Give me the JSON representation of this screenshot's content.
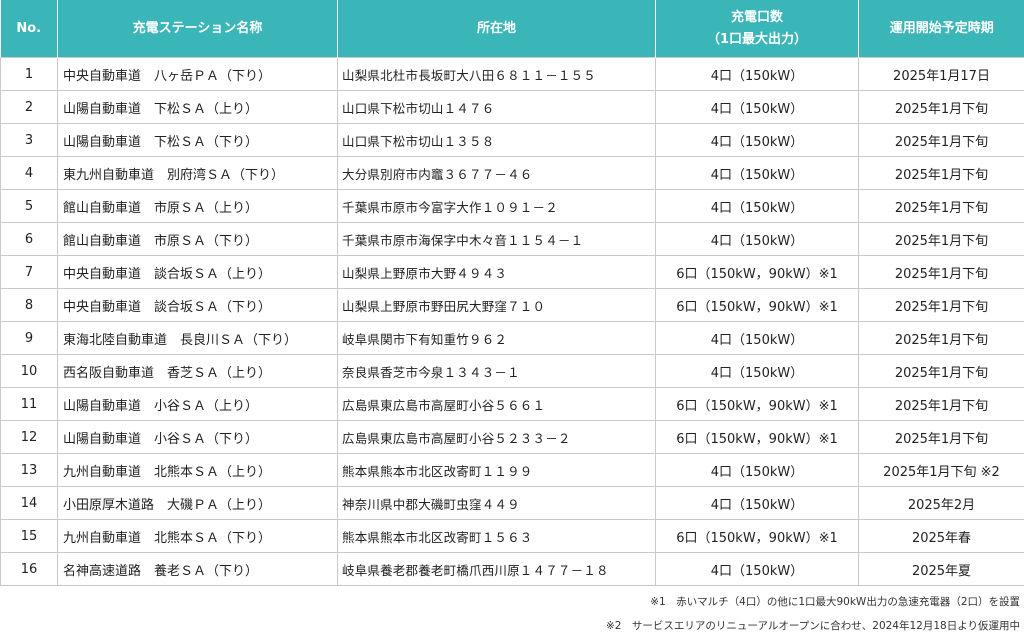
{
  "table": {
    "headers": {
      "no": "No.",
      "name": "充電ステーション名称",
      "address": "所在地",
      "capacity_line1": "充電口数",
      "capacity_line2": "（1口最大出力）",
      "date": "運用開始予定時期"
    },
    "rows": [
      {
        "no": "1",
        "name": "中央自動車道　八ヶ岳ＰＡ（下り）",
        "address": "山梨県北杜市長坂町大八田６８１１－１５５",
        "capacity": "4口（150kW）",
        "date": "2025年1月17日"
      },
      {
        "no": "2",
        "name": "山陽自動車道　下松ＳＡ（上り）",
        "address": "山口県下松市切山１４７６",
        "capacity": "4口（150kW）",
        "date": "2025年1月下旬"
      },
      {
        "no": "3",
        "name": "山陽自動車道　下松ＳＡ（下り）",
        "address": "山口県下松市切山１３５８",
        "capacity": "4口（150kW）",
        "date": "2025年1月下旬"
      },
      {
        "no": "4",
        "name": "東九州自動車道　別府湾ＳＡ（下り）",
        "address": "大分県別府市内竈３６７７－４６",
        "capacity": "4口（150kW）",
        "date": "2025年1月下旬"
      },
      {
        "no": "5",
        "name": "館山自動車道　市原ＳＡ（上り）",
        "address": "千葉県市原市今富字大作１０９１－２",
        "capacity": "4口（150kW）",
        "date": "2025年1月下旬"
      },
      {
        "no": "6",
        "name": "館山自動車道　市原ＳＡ（下り）",
        "address": "千葉県市原市海保字中木々音１１５４－１",
        "capacity": "4口（150kW）",
        "date": "2025年1月下旬"
      },
      {
        "no": "7",
        "name": "中央自動車道　談合坂ＳＡ（上り）",
        "address": "山梨県上野原市大野４９４３",
        "capacity": "6口（150kW，90kW）※1",
        "date": "2025年1月下旬"
      },
      {
        "no": "8",
        "name": "中央自動車道　談合坂ＳＡ（下り）",
        "address": "山梨県上野原市野田尻大野窪７１０",
        "capacity": "6口（150kW，90kW）※1",
        "date": "2025年1月下旬"
      },
      {
        "no": "9",
        "name": "東海北陸自動車道　長良川ＳＡ（下り）",
        "address": "岐阜県関市下有知重竹９６２",
        "capacity": "4口（150kW）",
        "date": "2025年1月下旬"
      },
      {
        "no": "10",
        "name": "西名阪自動車道　香芝ＳＡ（上り）",
        "address": "奈良県香芝市今泉１３４３－１",
        "capacity": "4口（150kW）",
        "date": "2025年1月下旬"
      },
      {
        "no": "11",
        "name": "山陽自動車道　小谷ＳＡ（上り）",
        "address": "広島県東広島市高屋町小谷５６６１",
        "capacity": "6口（150kW，90kW）※1",
        "date": "2025年1月下旬"
      },
      {
        "no": "12",
        "name": "山陽自動車道　小谷ＳＡ（下り）",
        "address": "広島県東広島市高屋町小谷５２３３－２",
        "capacity": "6口（150kW，90kW）※1",
        "date": "2025年1月下旬"
      },
      {
        "no": "13",
        "name": "九州自動車道　北熊本ＳＡ（上り）",
        "address": "熊本県熊本市北区改寄町１１９９",
        "capacity": "4口（150kW）",
        "date": "2025年1月下旬 ※2"
      },
      {
        "no": "14",
        "name": "小田原厚木道路　大磯ＰＡ（上り）",
        "address": "神奈川県中郡大磯町虫窪４４９",
        "capacity": "4口（150kW）",
        "date": "2025年2月"
      },
      {
        "no": "15",
        "name": "九州自動車道　北熊本ＳＡ（下り）",
        "address": "熊本県熊本市北区改寄町１５６３",
        "capacity": "6口（150kW，90kW）※1",
        "date": "2025年春"
      },
      {
        "no": "16",
        "name": "名神高速道路　養老ＳＡ（下り）",
        "address": "岐阜県養老郡養老町橋爪西川原１４７７－１８",
        "capacity": "4口（150kW）",
        "date": "2025年夏"
      }
    ]
  },
  "footnotes": {
    "note1": "※1　赤いマルチ（4口）の他に1口最大90kW出力の急速充電器（2口）を設置",
    "note2": "※2　サービスエリアのリニューアルオープンに合わせ、2024年12月18日より仮運用中"
  },
  "colors": {
    "header_bg": "#3ab5b8",
    "header_text": "#ffffff",
    "border": "#c9c9c9"
  }
}
